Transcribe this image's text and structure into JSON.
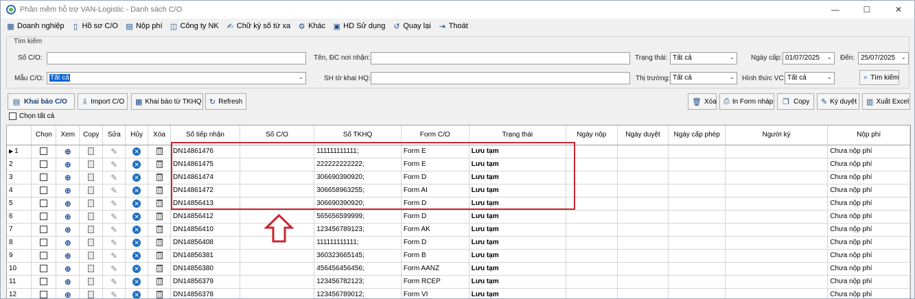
{
  "window": {
    "title": "Phần mềm hỗ trợ VAN-Logistic - Danh sách C/O",
    "min": "—",
    "max": "☐",
    "close": "✕"
  },
  "menu": [
    {
      "label": "Doanh nghiệp",
      "icon": "building-icon"
    },
    {
      "label": "Hồ sơ C/O",
      "icon": "document-icon"
    },
    {
      "label": "Nộp phí",
      "icon": "payment-icon"
    },
    {
      "label": "Công ty NK",
      "icon": "company-icon"
    },
    {
      "label": "Chữ ký số từ xa",
      "icon": "signature-icon"
    },
    {
      "label": "Khác",
      "icon": "gear-icon"
    },
    {
      "label": "HD Sử dụng",
      "icon": "help-icon"
    },
    {
      "label": "Quay lại",
      "icon": "back-icon"
    },
    {
      "label": "Thoát",
      "icon": "exit-icon"
    }
  ],
  "search": {
    "legend": "Tìm kiếm",
    "so_co_label": "Số C/O:",
    "so_co_value": "",
    "ten_dc_label": "Tên, ĐC nơi nhận:",
    "ten_dc_value": "",
    "trang_thai_label": "Trạng thái:",
    "trang_thai_value": "Tất cả",
    "ngay_cap_label": "Ngày cấp:",
    "ngay_cap_value": "01/07/2025",
    "den_label": "Đến:",
    "den_value": "25/07/2025",
    "mau_co_label": "Mẫu C/O:",
    "mau_co_value": "Tất cả",
    "sh_to_khai_label": "SH tờ khai HQ:",
    "sh_to_khai_value": "",
    "thi_truong_label": "Thị trường:",
    "thi_truong_value": "Tất cả",
    "hinh_thuc_label": "Hình thức VC:",
    "hinh_thuc_value": "Tất cả",
    "search_button": "Tìm kiếm"
  },
  "toolbar": {
    "khai_bao": "Khai báo C/O",
    "import": "Import C/O",
    "khai_bao_tkhq": "Khai báo từ TKHQ",
    "refresh": "Refresh",
    "xoa": "Xóa",
    "in_form": "In Form nháp",
    "copy": "Copy",
    "ky_duyet": "Ký duyệt",
    "xuat_excel": "Xuất Excel",
    "chon_tat_ca": "Chọn tất cả"
  },
  "grid": {
    "columns": [
      "Chọn",
      "Xem",
      "Copy",
      "Sửa",
      "Hủy",
      "Xóa",
      "Số tiếp nhận",
      "Số C/O",
      "Số TKHQ",
      "Form C/O",
      "Trạng thái",
      "Ngày nộp",
      "Ngày duyệt",
      "Ngày cấp phép",
      "Người ký",
      "Nộp phí"
    ],
    "rows": [
      {
        "no": "1",
        "so_tiep_nhan": "DN14861476",
        "so_co": "",
        "so_tkhq": "111111111111;",
        "form": "Form E",
        "trang_thai": "Lưu tạm",
        "nop_phi": "Chưa nộp phí"
      },
      {
        "no": "2",
        "so_tiep_nhan": "DN14861475",
        "so_co": "",
        "so_tkhq": "222222222222;",
        "form": "Form E",
        "trang_thai": "Lưu tạm",
        "nop_phi": "Chưa nộp phí"
      },
      {
        "no": "3",
        "so_tiep_nhan": "DN14861474",
        "so_co": "",
        "so_tkhq": "306690390920;",
        "form": "Form D",
        "trang_thai": "Lưu tạm",
        "nop_phi": "Chưa nộp phí"
      },
      {
        "no": "4",
        "so_tiep_nhan": "DN14861472",
        "so_co": "",
        "so_tkhq": "306658963255;",
        "form": "Form AI",
        "trang_thai": "Lưu tạm",
        "nop_phi": "Chưa nộp phí"
      },
      {
        "no": "5",
        "so_tiep_nhan": "DN14856413",
        "so_co": "",
        "so_tkhq": "306690390920;",
        "form": "Form D",
        "trang_thai": "Lưu tạm",
        "nop_phi": "Chưa nộp phí"
      },
      {
        "no": "6",
        "so_tiep_nhan": "DN14856412",
        "so_co": "",
        "so_tkhq": "565656599999;",
        "form": "Form D",
        "trang_thai": "Lưu tạm",
        "nop_phi": "Chưa nộp phí"
      },
      {
        "no": "7",
        "so_tiep_nhan": "DN14856410",
        "so_co": "",
        "so_tkhq": "123456789123;",
        "form": "Form AK",
        "trang_thai": "Lưu tạm",
        "nop_phi": "Chưa nộp phí"
      },
      {
        "no": "8",
        "so_tiep_nhan": "DN14856408",
        "so_co": "",
        "so_tkhq": "111111111111;",
        "form": "Form D",
        "trang_thai": "Lưu tạm",
        "nop_phi": "Chưa nộp phí"
      },
      {
        "no": "9",
        "so_tiep_nhan": "DN14856381",
        "so_co": "",
        "so_tkhq": "360323665145;",
        "form": "Form B",
        "trang_thai": "Lưu tạm",
        "nop_phi": "Chưa nộp phí"
      },
      {
        "no": "10",
        "so_tiep_nhan": "DN14856380",
        "so_co": "",
        "so_tkhq": "456456456456;",
        "form": "Form AANZ",
        "trang_thai": "Lưu tạm",
        "nop_phi": "Chưa nộp phí"
      },
      {
        "no": "11",
        "so_tiep_nhan": "DN14856379",
        "so_co": "",
        "so_tkhq": "123456782123;",
        "form": "Form RCEP",
        "trang_thai": "Lưu tạm",
        "nop_phi": "Chưa nộp phí"
      },
      {
        "no": "12",
        "so_tiep_nhan": "DN14856378",
        "so_co": "",
        "so_tkhq": "123456789012;",
        "form": "Form VI",
        "trang_thai": "Lưu tạm",
        "nop_phi": "Chưa nộp phí"
      }
    ]
  },
  "annotation": {
    "highlight_color": "#c9252f"
  }
}
